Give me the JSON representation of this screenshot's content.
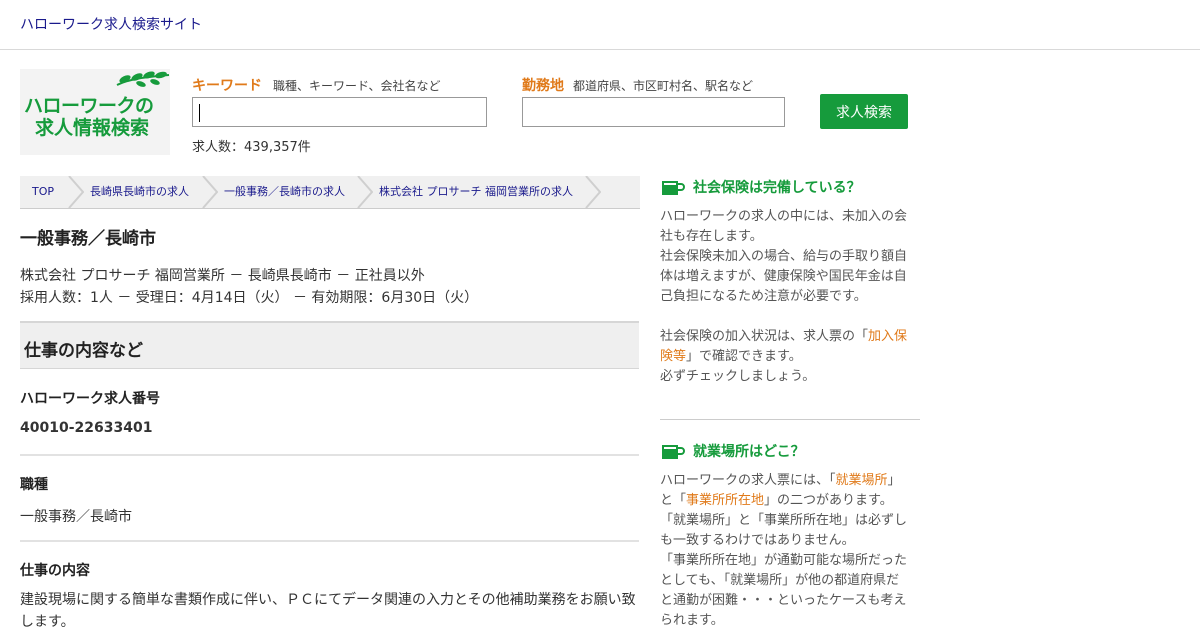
{
  "header": {
    "site_title": "ハローワーク求人検索サイト"
  },
  "logo": {
    "line1": "ハローワークの",
    "line2": "求人情報検索"
  },
  "search": {
    "keyword_label": "キーワード",
    "keyword_hint": "職種、キーワード、会社名など",
    "keyword_value": "",
    "location_label": "勤務地",
    "location_hint": "都道府県、市区町村名、駅名など",
    "location_value": "",
    "button_label": "求人検索",
    "count_text": "求人数：439,357件"
  },
  "breadcrumb": [
    "TOP",
    "長崎県長崎市の求人",
    "一般事務／長崎市の求人",
    "株式会社 プロサーチ 福岡営業所の求人"
  ],
  "job": {
    "title": "一般事務／長崎市",
    "meta_line1": "株式会社 プロサーチ 福岡営業所 － 長崎県長崎市 － 正社員以外",
    "meta_line2": "採用人数：1人 － 受理日：4月14日（火） － 有効期限：6月30日（火）",
    "section_title": "仕事の内容など",
    "number_label": "ハローワーク求人番号",
    "number_value": "40010-22633401",
    "occupation_label": "職種",
    "occupation_value": "一般事務／長崎市",
    "content_label": "仕事の内容",
    "content_value": "建設現場に関する簡単な書類作成に伴い、ＰＣにてデータ関連の入力とその他補助業務をお願い致します。"
  },
  "sidebar": {
    "insurance": {
      "title": "社会保険は完備している？",
      "p1": "ハローワークの求人の中には、未加入の会社も存在します。",
      "p2": "社会保険未加入の場合、給与の手取り額自体は増えますが、健康保険や国民年金は自己負担になるため注意が必要です。",
      "p3_pre": "社会保険の加入状況は、求人票の「",
      "p3_link": "加入保険等",
      "p3_post": "」で確認できます。",
      "p4": "必ずチェックしましょう。"
    },
    "workplace": {
      "title": "就業場所はどこ？",
      "p1_pre": "ハローワークの求人票には、「",
      "p1_link1": "就業場所",
      "p1_mid": "」と「",
      "p1_link2": "事業所所在地",
      "p1_post": "」の二つがあります。",
      "p2": "「就業場所」と「事業所所在地」は必ずしも一致するわけではありません。",
      "p3": "「事業所所在地」が通勤可能な場所だったとしても、「就業場所」が他の都道府県だと通勤が困難・・・といったケースも考えられます。"
    }
  },
  "colors": {
    "accent_green": "#169b3c",
    "accent_orange": "#e07a1a",
    "link_blue": "#1a1a8c"
  }
}
